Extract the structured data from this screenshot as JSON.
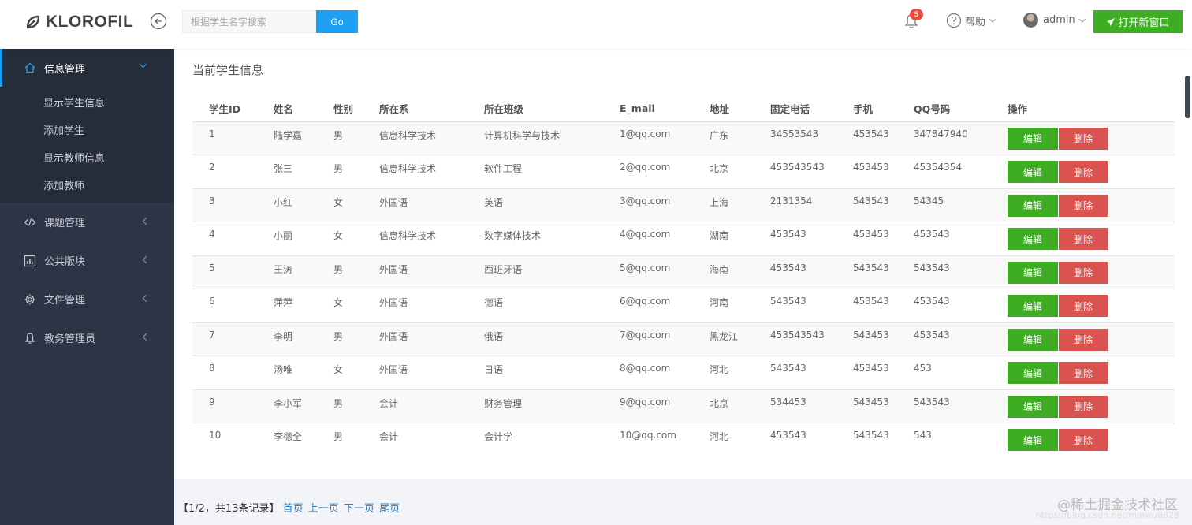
{
  "brand": {
    "name": "KLOROFIL"
  },
  "search": {
    "placeholder": "根据学生名字搜索",
    "button_label": "Go"
  },
  "header": {
    "notification_count": "5",
    "help_label": "帮助",
    "user_label": "admin",
    "open_window_label": "打开新窗口"
  },
  "sidebar": {
    "items": [
      {
        "label": "信息管理",
        "icon": "home-icon",
        "active": true
      },
      {
        "label": "课题管理",
        "icon": "code-icon"
      },
      {
        "label": "公共版块",
        "icon": "bar-chart-icon"
      },
      {
        "label": "文件管理",
        "icon": "gear-icon"
      },
      {
        "label": "教务管理员",
        "icon": "bell-icon"
      }
    ],
    "submenu": [
      "显示学生信息",
      "添加学生",
      "显示教师信息",
      "添加教师"
    ]
  },
  "main": {
    "title": "当前学生信息",
    "columns": [
      "学生ID",
      "姓名",
      "性别",
      "所在系",
      "所在班级",
      "E_mail",
      "地址",
      "固定电话",
      "手机",
      "QQ号码",
      "操作"
    ],
    "edit_label": "编辑",
    "delete_label": "删除",
    "rows": [
      [
        "1",
        "陆学嘉",
        "男",
        "信息科学技术",
        "计算机科学与技术",
        "1@qq.com",
        "广东",
        "34553543",
        "453543",
        "347847940"
      ],
      [
        "2",
        "张三",
        "男",
        "信息科学技术",
        "软件工程",
        "2@qq.com",
        "北京",
        "453543543",
        "453453",
        "45354354"
      ],
      [
        "3",
        "小红",
        "女",
        "外国语",
        "英语",
        "3@qq.com",
        "上海",
        "2131354",
        "543543",
        "54345"
      ],
      [
        "4",
        "小丽",
        "女",
        "信息科学技术",
        "数字媒体技术",
        "4@qq.com",
        "湖南",
        "453543",
        "453453",
        "453543"
      ],
      [
        "5",
        "王涛",
        "男",
        "外国语",
        "西班牙语",
        "5@qq.com",
        "海南",
        "453543",
        "543543",
        "543543"
      ],
      [
        "6",
        "萍萍",
        "女",
        "外国语",
        "德语",
        "6@qq.com",
        "河南",
        "543543",
        "453543",
        "453543"
      ],
      [
        "7",
        "李明",
        "男",
        "外国语",
        "俄语",
        "7@qq.com",
        "黑龙江",
        "453543543",
        "543453",
        "453543"
      ],
      [
        "8",
        "汤唯",
        "女",
        "外国语",
        "日语",
        "8@qq.com",
        "河北",
        "543543",
        "453453",
        "453"
      ],
      [
        "9",
        "李小军",
        "男",
        "会计",
        "财务管理",
        "9@qq.com",
        "北京",
        "534453",
        "543453",
        "543543"
      ],
      [
        "10",
        "李德全",
        "男",
        "会计",
        "会计学",
        "10@qq.com",
        "河北",
        "453543",
        "543543",
        "543"
      ]
    ]
  },
  "pagination": {
    "summary": "【1/2，共13条记录】",
    "first": "首页",
    "prev": "上一页",
    "next": "下一页",
    "last": "尾页"
  },
  "watermark": {
    "text": "@稀土掘金技术社区",
    "url": "https://blog.csdn.net/minwu0828"
  },
  "colors": {
    "accent": "#1e9ff2",
    "success": "#3fad24",
    "danger": "#d9534f",
    "sidebar": "#2d3446"
  }
}
